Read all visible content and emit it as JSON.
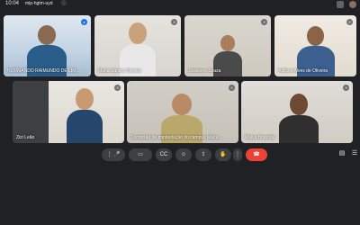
{
  "topbar": {
    "time": "10:04",
    "meeting_code": "mip-hgtm-uyd",
    "info_icon": "info-icon"
  },
  "participants": [
    {
      "name": "NORMANDO RAIMUNDO DE LIM...",
      "state": "speaking"
    },
    {
      "name": "Maria Santos Oliveira",
      "state": "muted"
    },
    {
      "name": "Jussilene Souza",
      "state": "muted"
    },
    {
      "name": "Adilson Alves de Oliveira",
      "state": "muted"
    },
    {
      "name": "Zizi Leão",
      "state": "muted"
    },
    {
      "name": "Comissão de Implantação do campus Maca...",
      "state": "muted"
    },
    {
      "name": "Maisa Brandão",
      "state": "muted"
    }
  ],
  "controls": {
    "more_options_label": "⋮",
    "mic_label": "🎤",
    "camera_label": "▭",
    "captions_label": "CC",
    "emoji_label": "☺",
    "present_label": "⇪",
    "raise_hand_label": "✋",
    "overflow_label": "⋮",
    "end_call_label": "☎"
  },
  "colors": {
    "background": "#202124",
    "tile": "#3c4043",
    "end_call": "#ea4335",
    "accent": "#1a73e8"
  }
}
